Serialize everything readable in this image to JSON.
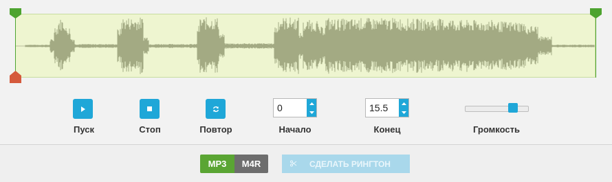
{
  "waveform": {
    "colors": {
      "background": "#eef5d0",
      "border": "#c7dca0",
      "wave": "#a3aa83",
      "center": "#b8bd9c"
    }
  },
  "markers": {
    "start_color": "#4da32f",
    "end_color": "#4da32f",
    "playhead_color": "#d55a3c"
  },
  "controls": {
    "play": {
      "label": "Пуск",
      "icon": "play-icon"
    },
    "stop": {
      "label": "Стоп",
      "icon": "stop-icon"
    },
    "repeat": {
      "label": "Повтор",
      "icon": "repeat-icon"
    },
    "start": {
      "label": "Начало",
      "value": "0"
    },
    "end": {
      "label": "Конец",
      "value": "15.5"
    },
    "volume": {
      "label": "Громкость",
      "level": 0.8
    }
  },
  "bottom": {
    "formats": [
      "MP3",
      "M4R"
    ],
    "selected_format": "MP3",
    "make_label": "СДЕЛАТЬ РИНГТОН",
    "make_icon": "scissors-icon"
  },
  "accent_color": "#1fa7d8"
}
